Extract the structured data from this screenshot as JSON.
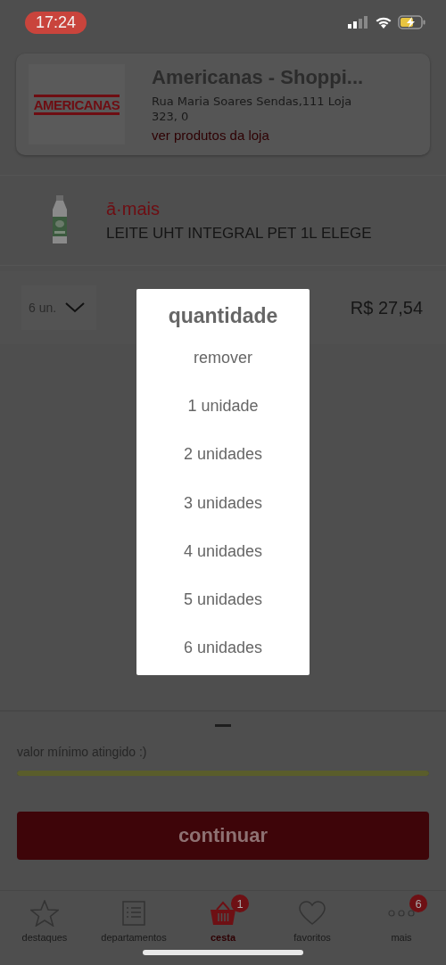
{
  "status_bar": {
    "time": "17:24"
  },
  "store": {
    "logo": "AMERICANAS",
    "name": "Americanas - Shoppi...",
    "address": "Rua Maria Soares Sendas,111  Loja 323, 0",
    "link": "ver produtos da loja"
  },
  "product": {
    "brand": "ā·mais",
    "name": "LEITE UHT INTEGRAL PET 1L ELEGE",
    "quantity": "6 un.",
    "price": "R$ 27,54"
  },
  "quantity_dialog": {
    "title": "quantidade",
    "options": [
      {
        "label": "remover"
      },
      {
        "label": "1 unidade"
      },
      {
        "label": "2 unidades"
      },
      {
        "label": "3 unidades"
      },
      {
        "label": "4 unidades"
      },
      {
        "label": "5 unidades"
      },
      {
        "label": "6 unidades"
      }
    ]
  },
  "summary": {
    "message": "valor mínimo atingido :)",
    "level": 1,
    "button": "continuar"
  },
  "tabs": [
    {
      "kind": "star",
      "label": "destaques",
      "selected": false
    },
    {
      "kind": "list",
      "label": "departamentos",
      "selected": false
    },
    {
      "kind": "basket",
      "label": "cesta",
      "selected": true,
      "badge": "1"
    },
    {
      "kind": "heart",
      "label": "favoritos",
      "selected": false
    },
    {
      "kind": "dots",
      "label": "mais",
      "selected": false,
      "badge": "6"
    }
  ]
}
